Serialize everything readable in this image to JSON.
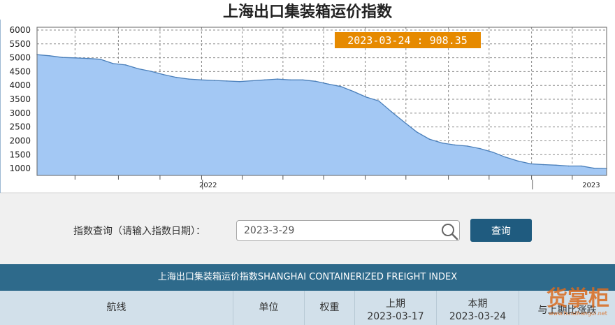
{
  "chart_data": {
    "type": "area",
    "title": "上海出口集装箱运价指数",
    "y_ticks": [
      6000,
      5500,
      5000,
      4500,
      4000,
      3500,
      3000,
      2500,
      2000,
      1500,
      1000
    ],
    "ylim": [
      750,
      6100
    ],
    "x_tick_labels": [
      "2022",
      "2023"
    ],
    "grid": true,
    "fill_color": "#a3c8f4",
    "line_color": "#4a7fba",
    "tooltip": "2023-03-24 : 908.35",
    "tooltip_color": "#e68a00",
    "series": [
      {
        "x": [
          "2021-07-02",
          "2021-07-16",
          "2021-07-30",
          "2021-08-13",
          "2021-08-27",
          "2021-09-10",
          "2021-09-24",
          "2021-10-08",
          "2021-10-22",
          "2021-11-05",
          "2021-11-19",
          "2021-12-03",
          "2021-12-17",
          "2021-12-31",
          "2022-01-14",
          "2022-01-28",
          "2022-02-11",
          "2022-02-25",
          "2022-03-11",
          "2022-03-25",
          "2022-04-08",
          "2022-04-22",
          "2022-05-06",
          "2022-05-20",
          "2022-06-03",
          "2022-06-17",
          "2022-07-01",
          "2022-07-15",
          "2022-07-29",
          "2022-08-12",
          "2022-08-26",
          "2022-09-09",
          "2022-09-23",
          "2022-10-07",
          "2022-10-21",
          "2022-11-04",
          "2022-11-18",
          "2022-12-02",
          "2022-12-16",
          "2022-12-30",
          "2023-01-13",
          "2023-01-27",
          "2023-02-10",
          "2023-02-24",
          "2023-03-10",
          "2023-03-24"
        ],
        "y": [
          5110,
          5070,
          5010,
          4995,
          4975,
          4945,
          4790,
          4740,
          4600,
          4510,
          4390,
          4290,
          4230,
          4200,
          4180,
          4160,
          4140,
          4170,
          4200,
          4230,
          4200,
          4200,
          4150,
          4050,
          3960,
          3780,
          3580,
          3440,
          3050,
          2680,
          2320,
          2060,
          1920,
          1850,
          1810,
          1720,
          1590,
          1410,
          1270,
          1170,
          1140,
          1120,
          1090,
          1090,
          1010,
          1000
        ]
      }
    ]
  },
  "query": {
    "label": "指数查询（请输入指数日期）：",
    "input_value": "2023-3-29",
    "button_label": "查询"
  },
  "table": {
    "banner_title": "上海出口集装箱运价指数SHANGHAI CONTAINERIZED FREIGHT INDEX",
    "headers": {
      "route": "航线",
      "unit": "单位",
      "weight": "权重",
      "prev_label": "上期",
      "prev_date": "2023-03-17",
      "curr_label": "本期",
      "curr_date": "2023-03-24",
      "change": "与上期比涨跌"
    }
  },
  "watermark": {
    "name": "货掌柜",
    "url": "www.huozhangui.net"
  }
}
